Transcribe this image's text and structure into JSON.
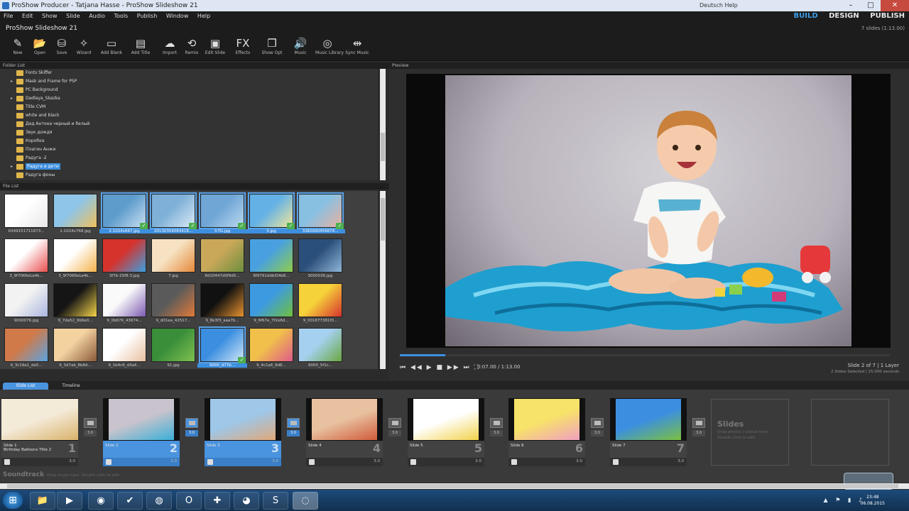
{
  "window": {
    "title": "ProShow Producer - Tatjana Hasse - ProShow Slideshow 21",
    "user_label": "Deutsch    Help",
    "controls": [
      "–",
      "□",
      "✕"
    ]
  },
  "menu": [
    "File",
    "Edit",
    "Show",
    "Slide",
    "Audio",
    "Tools",
    "Publish",
    "Window",
    "Help"
  ],
  "modes": {
    "build": "BUILD",
    "design": "DESIGN",
    "publish": "PUBLISH"
  },
  "project": {
    "name": "ProShow Slideshow 21",
    "slide_count": "7 slides (1:13.00)"
  },
  "toolbar": [
    {
      "label": "New",
      "icon": "new-show-icon",
      "glyph": "✎"
    },
    {
      "label": "Open",
      "icon": "open-folder-icon",
      "glyph": "📂"
    },
    {
      "label": "Save",
      "icon": "save-icon",
      "glyph": "⛁"
    },
    {
      "label": "Wizard",
      "icon": "wizard-icon",
      "glyph": "✧"
    },
    {
      "label": "Add Blank",
      "icon": "add-blank-icon",
      "glyph": "▭"
    },
    {
      "label": "Add Title",
      "icon": "add-title-icon",
      "glyph": "▤"
    },
    {
      "label": "Import",
      "icon": "import-icon",
      "glyph": "☁"
    },
    {
      "label": "Remix",
      "icon": "remix-icon",
      "glyph": "⟲"
    },
    {
      "label": "Edit Slide",
      "icon": "edit-slide-icon",
      "glyph": "▣"
    },
    {
      "label": "Effects",
      "icon": "effects-icon",
      "glyph": "FX"
    },
    {
      "label": "Show Opt",
      "icon": "show-options-icon",
      "glyph": "❐"
    },
    {
      "label": "Music",
      "icon": "music-icon",
      "glyph": "🔊"
    },
    {
      "label": "Music Library",
      "icon": "music-library-icon",
      "glyph": "◎"
    },
    {
      "label": "Sync Music",
      "icon": "sync-music-icon",
      "glyph": "⇹"
    }
  ],
  "panels": {
    "folder_list": "Folder List",
    "file_list": "File List",
    "preview": "Preview"
  },
  "folders": [
    {
      "name": "Fonts Skiffer",
      "arrow": ""
    },
    {
      "name": "Mask and Frame for PSP",
      "arrow": "▸"
    },
    {
      "name": "PC Background",
      "arrow": ""
    },
    {
      "name": "Dadlaya_Skazka",
      "arrow": "▸"
    },
    {
      "name": "Title CVM",
      "arrow": ""
    },
    {
      "name": "white and black",
      "arrow": ""
    },
    {
      "name": "Дед Антона черный и белый",
      "arrow": ""
    },
    {
      "name": "Звук дождя",
      "arrow": ""
    },
    {
      "name": "Коробка",
      "arrow": ""
    },
    {
      "name": "Плагин Анжи",
      "arrow": ""
    },
    {
      "name": "Радуга -2",
      "arrow": ""
    },
    {
      "name": "Радуга и дети",
      "arrow": "▸",
      "selected": true
    },
    {
      "name": "Радуга фоны",
      "arrow": ""
    }
  ],
  "files": [
    {
      "name": "6349151711673...",
      "colors": [
        "#ffffff",
        "#e8e8e8"
      ]
    },
    {
      "name": "1-1024x768.jpg",
      "colors": [
        "#8ec5e8",
        "#f0c05a"
      ]
    },
    {
      "name": "2-1024x667.jpg",
      "colors": [
        "#5e9ccc",
        "#c8dff0"
      ],
      "selected": true
    },
    {
      "name": "20130354083418...",
      "colors": [
        "#7fb1d8",
        "#d9e9f4"
      ],
      "selected": true
    },
    {
      "name": "3-TG.jpg",
      "colors": [
        "#6fa6d6",
        "#bcd8ee"
      ],
      "selected": true
    },
    {
      "name": "3.jpg",
      "colors": [
        "#64b1e6",
        "#f0e69a"
      ],
      "selected": true
    },
    {
      "name": "3382690456674...",
      "colors": [
        "#88c0e2",
        "#e8b2a0"
      ],
      "selected": true
    },
    {
      "name": "3_9f7066eLe4k...",
      "colors": [
        "#ffffff",
        "#e94e4e"
      ]
    },
    {
      "name": "3_9f7066eLe4k...",
      "colors": [
        "#ffffff",
        "#f3b24a"
      ]
    },
    {
      "name": "3f7b-25f8-3.jpg",
      "colors": [
        "#d6332d",
        "#3aa0e0"
      ]
    },
    {
      "name": "7.jpg",
      "colors": [
        "#f6e2c2",
        "#e6883a"
      ]
    },
    {
      "name": "8d10447d0f9d5...",
      "colors": [
        "#c9a85a",
        "#6d8e3c"
      ]
    },
    {
      "name": "8f9791ddbf24b8...",
      "colors": [
        "#48a0e0",
        "#8fcd4a"
      ]
    },
    {
      "name": "9000036.jpg",
      "colors": [
        "#2a4f7a",
        "#8fb6d8"
      ]
    },
    {
      "name": "9000076.jpg",
      "colors": [
        "#f2f2f2",
        "#aab7e0"
      ]
    },
    {
      "name": "9_7da52_9b6e0...",
      "colors": [
        "#151515",
        "#f5d44a"
      ]
    },
    {
      "name": "9_0b676_43674...",
      "colors": [
        "#fafafa",
        "#7c5ab0"
      ]
    },
    {
      "name": "9_d01ea_42517...",
      "colors": [
        "#5a5a5a",
        "#e07a3a"
      ]
    },
    {
      "name": "9_8e3f3_aaa7b...",
      "colors": [
        "#111111",
        "#e8932f"
      ]
    },
    {
      "name": "9_6f67e_7f2e6d...",
      "colors": [
        "#3d9ae0",
        "#6fc03e"
      ]
    },
    {
      "name": "9_001877381f0...",
      "colors": [
        "#f5d23a",
        "#d6332d"
      ]
    },
    {
      "name": "9_3c19a1_da5...",
      "colors": [
        "#d07a4a",
        "#5aa3e0"
      ]
    },
    {
      "name": "9_3d7ab_8b8d...",
      "colors": [
        "#f3d2a0",
        "#8a5a3a"
      ]
    },
    {
      "name": "9_1b4c6_d3a4...",
      "colors": [
        "#ffffff",
        "#e9c0a0"
      ]
    },
    {
      "name": "91.jpg",
      "colors": [
        "#3a8e3a",
        "#7ec050"
      ]
    },
    {
      "name": "9000_d77b...",
      "colors": [
        "#3c8fe0",
        "#cfe7f8"
      ],
      "selected": true
    },
    {
      "name": "9_4c1a6_8d6...",
      "colors": [
        "#f0c04a",
        "#e05a8a"
      ]
    },
    {
      "name": "9000_5f1c...",
      "colors": [
        "#a6d0f0",
        "#6aa840"
      ]
    }
  ],
  "playback": {
    "controls": "⏮ ◀◀ ▶ ■ ▶▶ ⏭ ⛶",
    "timecode": "0:07.00 / 1:13.00",
    "slide_info": "Slide 2 of 7  |  1 Layer",
    "selection_info": "2 Slides Selected  |  25.000 seconds",
    "progress_fraction": 0.093
  },
  "tabs": {
    "slide_list": "Slide List",
    "timeline": "Timeline"
  },
  "slides": [
    {
      "label": "Slide 1",
      "sub": "Birthday Balloons Title 2",
      "num": "1",
      "dur": "3.0",
      "colors": [
        "#f4ead8",
        "#d9b26a"
      ],
      "selected": false
    },
    {
      "label": "Slide 2",
      "sub": "",
      "num": "2",
      "dur": "3.0",
      "colors": [
        "#c8c3cc",
        "#3ab0d8"
      ],
      "selected": true
    },
    {
      "label": "Slide 3",
      "sub": "",
      "num": "3",
      "dur": "3.0",
      "colors": [
        "#9ec7e8",
        "#e0a87a"
      ],
      "selected": true
    },
    {
      "label": "Slide 4",
      "sub": "",
      "num": "4",
      "dur": "3.0",
      "colors": [
        "#e8c2a0",
        "#d05a3a"
      ],
      "selected": false
    },
    {
      "label": "Slide 5",
      "sub": "",
      "num": "5",
      "dur": "3.0",
      "colors": [
        "#ffffff",
        "#f2d24a"
      ],
      "selected": false
    },
    {
      "label": "Slide 6",
      "sub": "",
      "num": "6",
      "dur": "3.0",
      "colors": [
        "#f7e26a",
        "#f0a0c0"
      ],
      "selected": false
    },
    {
      "label": "Slide 7",
      "sub": "",
      "num": "7",
      "dur": "3.0",
      "colors": [
        "#3c8fe0",
        "#7bc040"
      ],
      "selected": false
    }
  ],
  "transitions": [
    {
      "dur": "3.0",
      "selected": false
    },
    {
      "dur": "3.0",
      "selected": true
    },
    {
      "dur": "3.0",
      "selected": true
    },
    {
      "dur": "3.0",
      "selected": false
    },
    {
      "dur": "3.0",
      "selected": false
    },
    {
      "dur": "3.0",
      "selected": false
    },
    {
      "dur": "3.0",
      "selected": false
    }
  ],
  "placeholder": {
    "title": "Slides",
    "hint": "Drop photos / videos here. Double click to edit."
  },
  "soundtrack": {
    "title": "Soundtrack",
    "hint": "Drop music here. Double click to edit."
  },
  "taskbar": {
    "apps": [
      {
        "name": "explorer",
        "glyph": "📁"
      },
      {
        "name": "media-player",
        "glyph": "▶"
      },
      {
        "name": "proshow-tray",
        "glyph": "◉"
      },
      {
        "name": "tasks",
        "glyph": "✔"
      },
      {
        "name": "chrome",
        "glyph": "◍"
      },
      {
        "name": "opera",
        "glyph": "O"
      },
      {
        "name": "office",
        "glyph": "✚"
      },
      {
        "name": "firefox",
        "glyph": "◕"
      },
      {
        "name": "skype",
        "glyph": "S"
      },
      {
        "name": "proshow",
        "glyph": "◌",
        "active": true
      }
    ],
    "tray": "▲ ⚑ ▮ ♪",
    "time": "23:48",
    "date": "06.08.2015"
  },
  "colors": {
    "accent": "#3d8fe0",
    "panel": "#333333",
    "background": "#2b2b2b"
  }
}
